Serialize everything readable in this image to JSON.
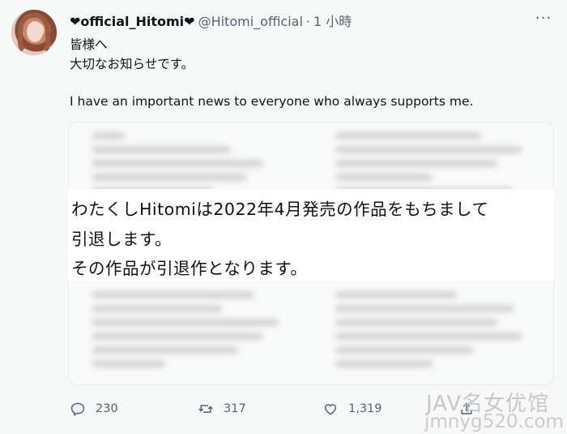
{
  "tweet": {
    "display_name": "❤official_Hitomi❤",
    "handle": "@Hitomi_official",
    "separator": "·",
    "time": "1 小時",
    "text_lines": [
      "皆様へ",
      "大切なお知らせです。",
      "I have an important news to everyone who always supports me."
    ],
    "image_notice_lines": [
      "わたくしHitomiは2022年4月発売の作品をもちまして",
      "引退します。",
      "その作品が引退作となります。"
    ],
    "more_icon": "more-horizontal-icon"
  },
  "actions": {
    "reply": {
      "icon": "reply-icon",
      "count": "230"
    },
    "retweet": {
      "icon": "retweet-icon",
      "count": "317"
    },
    "like": {
      "icon": "heart-icon",
      "count": "1,319"
    },
    "share": {
      "icon": "share-icon"
    }
  },
  "watermark": {
    "line1": "JAV名女优馆",
    "line2": "jmnyg520.com"
  },
  "colors": {
    "background": "#f7f9f9",
    "text": "#0f1419",
    "secondary": "#536471"
  }
}
